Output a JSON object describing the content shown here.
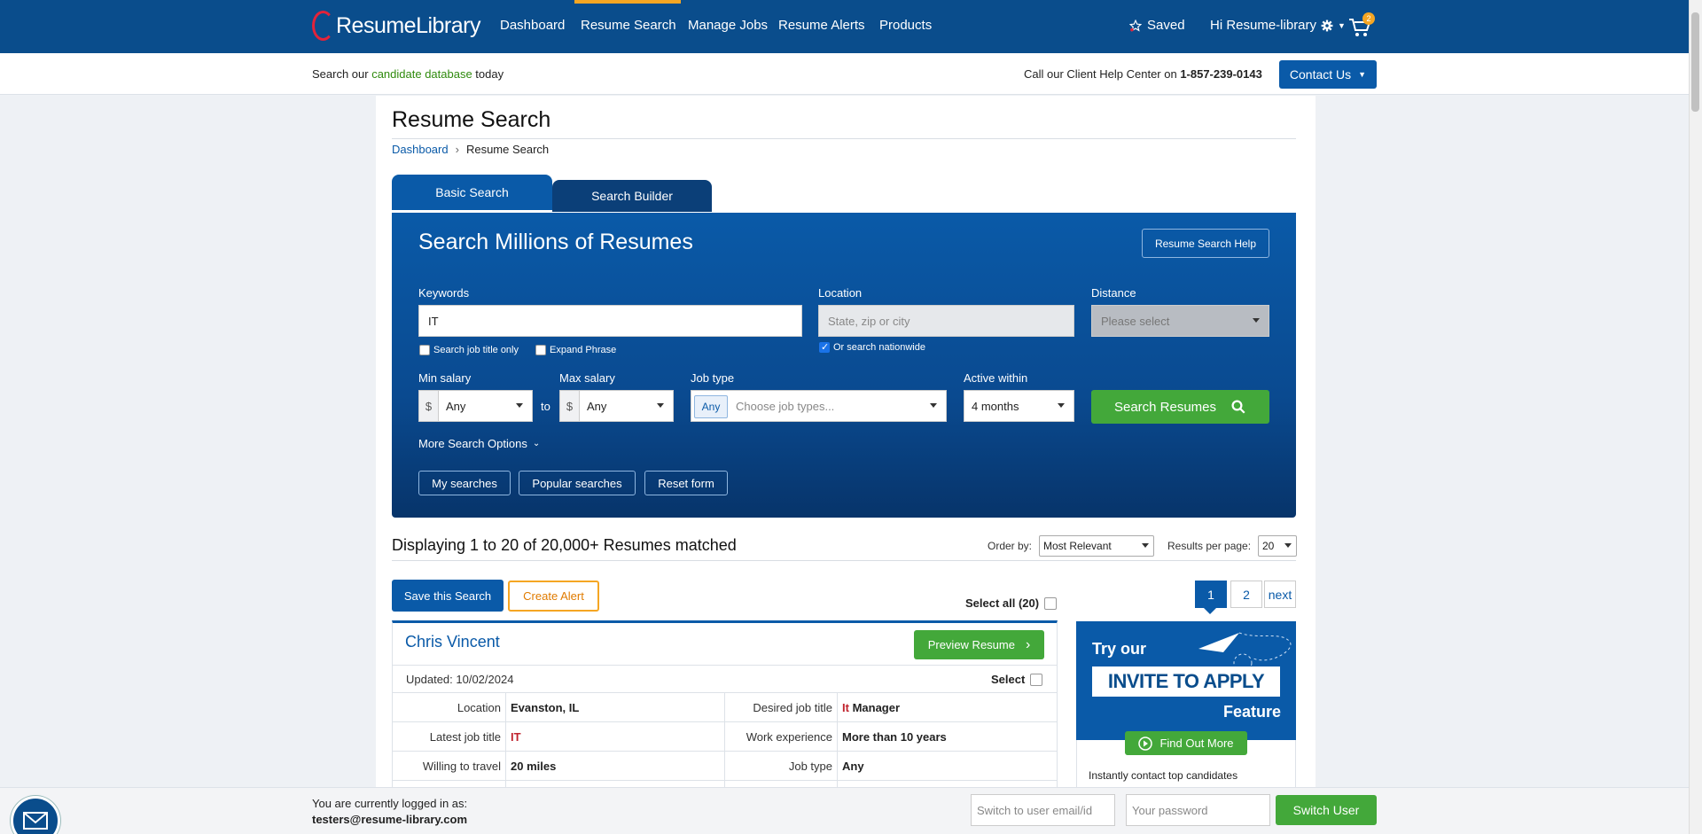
{
  "nav": {
    "logo_text": "ResumeLibrary",
    "links": [
      "Dashboard",
      "Resume Search",
      "Manage Jobs",
      "Resume Alerts",
      "Products"
    ],
    "saved_label": "Saved",
    "greeting": "Hi Resume-library",
    "cart_count": "2"
  },
  "subbar": {
    "prefix": "Search our ",
    "link": "candidate database",
    "suffix": " today",
    "help_text": "Call our Client Help Center on ",
    "phone": "1-857-239-0143",
    "contact_label": "Contact Us"
  },
  "page": {
    "title": "Resume Search",
    "breadcrumb": [
      "Dashboard",
      "Resume Search"
    ]
  },
  "tabs": [
    "Basic Search",
    "Search Builder"
  ],
  "search": {
    "heading": "Search Millions of Resumes",
    "help_button": "Resume Search Help",
    "keywords_label": "Keywords",
    "keywords_value": "IT",
    "job_title_only": "Search job title only",
    "expand_phrase": "Expand Phrase",
    "location_label": "Location",
    "location_placeholder": "State, zip or city",
    "nationwide": "Or search nationwide",
    "distance_label": "Distance",
    "distance_placeholder": "Please select",
    "min_salary_label": "Min salary",
    "max_salary_label": "Max salary",
    "currency": "$",
    "min_salary": "Any",
    "to": "to",
    "max_salary": "Any",
    "job_type_label": "Job type",
    "job_type_chip": "Any",
    "job_type_placeholder": "Choose job types...",
    "active_label": "Active within",
    "active_value": "4 months",
    "search_button": "Search Resumes",
    "more_options": "More Search Options",
    "my_searches": "My searches",
    "popular_searches": "Popular searches",
    "reset_form": "Reset form"
  },
  "results": {
    "heading": "Displaying 1 to 20 of 20,000+ Resumes matched",
    "order_label": "Order by:",
    "order_value": "Most Relevant",
    "rpp_label": "Results per page:",
    "rpp_value": "20",
    "save_search": "Save this Search",
    "create_alert": "Create Alert",
    "select_all": "Select all (20)",
    "pages": [
      "1",
      "2",
      "next"
    ]
  },
  "candidate": {
    "name": "Chris Vincent",
    "preview_button": "Preview Resume",
    "updated": "Updated: 10/02/2024",
    "select_label": "Select",
    "rows": [
      {
        "label": "Location",
        "value": "Evanston, IL"
      },
      {
        "label": "Latest job title",
        "value": "IT"
      },
      {
        "label": "Willing to travel",
        "value": "20 miles"
      }
    ],
    "rows_right": [
      {
        "label": "Desired job title",
        "value_highlight": "It",
        "value_rest": " Manager"
      },
      {
        "label": "Work experience",
        "value": "More than 10 years"
      },
      {
        "label": "Job type",
        "value": "Any"
      }
    ]
  },
  "promo": {
    "try": "Try our",
    "box": "INVITE TO APPLY",
    "feature": "Feature",
    "button": "Find Out More",
    "text": "Instantly contact top candidates"
  },
  "bottom": {
    "logged_label": "You are currently logged in as:",
    "logged_user": "testers@resume-library.com",
    "switch_placeholder": "Switch to user email/id",
    "password_placeholder": "Your password",
    "switch_button": "Switch User"
  },
  "colors": {
    "brand_blue": "#0a4d8c",
    "accent_orange": "#f5a623",
    "green": "#43a83a",
    "highlight_red": "#c0232d"
  }
}
